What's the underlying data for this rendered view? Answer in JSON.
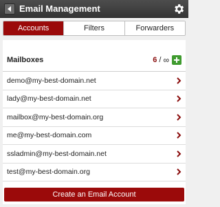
{
  "header": {
    "title": "Email Management",
    "back_icon": "back-icon",
    "settings_icon": "gear-icon"
  },
  "tabs": [
    {
      "label": "Accounts",
      "active": true
    },
    {
      "label": "Filters",
      "active": false
    },
    {
      "label": "Forwarders",
      "active": false
    }
  ],
  "mailboxes": {
    "title": "Mailboxes",
    "count": "6",
    "separator": "/",
    "limit": "∞",
    "add_icon": "plus-icon"
  },
  "accounts": [
    "demo@my-best-domain.net",
    "lady@my-best-domain.net",
    "mailbox@my-best-domain.org",
    "me@my-best-domain.com",
    "ssladmin@my-best-domain.net",
    "test@my-best-domain.org"
  ],
  "actions": {
    "create_label": "Create an Email Account"
  },
  "colors": {
    "accent": "#9b0a0a",
    "topbar": "#3f3f3f",
    "add_green": "#3f9b2f"
  }
}
